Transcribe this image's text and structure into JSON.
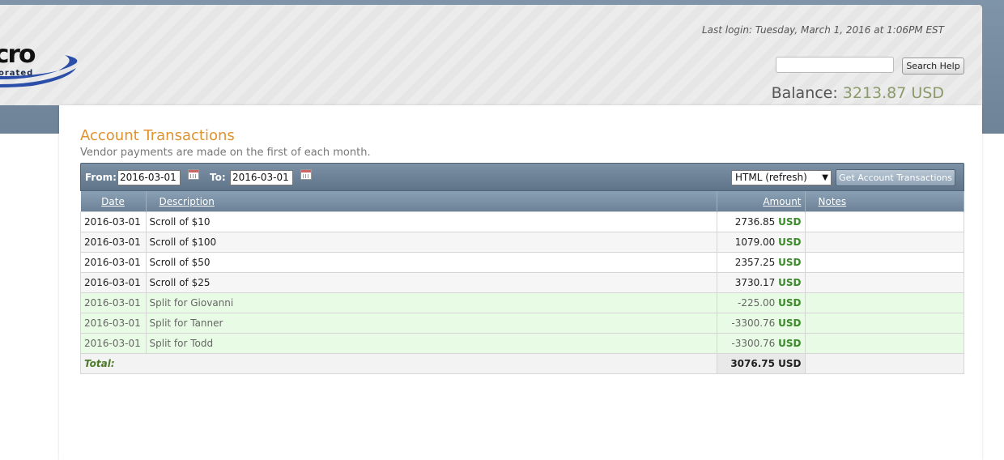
{
  "header": {
    "logo_mark": "cro",
    "logo_sub": "orated",
    "last_login": "Last login: Tuesday, March 1, 2016 at 1:06PM EST",
    "search_button": "Search Help",
    "balance_label": "Balance:",
    "balance_amount": "3213.87 USD"
  },
  "page": {
    "title": "Account Transactions",
    "subtitle": "Vendor payments are made on the first of each month."
  },
  "toolbar": {
    "from_label": "From:",
    "from_value": "2016-03-01",
    "to_label": "To:",
    "to_value": "2016-03-01",
    "format_value": "HTML (refresh)",
    "get_button": "Get Account Transactions"
  },
  "table": {
    "headers": {
      "date": "Date",
      "description": "Description",
      "amount": "Amount",
      "notes": "Notes"
    },
    "rows": [
      {
        "date": "2016-03-01",
        "description": "Scroll of $10",
        "amount": "2736.85",
        "currency": "USD",
        "notes": ""
      },
      {
        "date": "2016-03-01",
        "description": "Scroll of $100",
        "amount": "1079.00",
        "currency": "USD",
        "notes": ""
      },
      {
        "date": "2016-03-01",
        "description": "Scroll of $50",
        "amount": "2357.25",
        "currency": "USD",
        "notes": ""
      },
      {
        "date": "2016-03-01",
        "description": "Scroll of $25",
        "amount": "3730.17",
        "currency": "USD",
        "notes": ""
      },
      {
        "date": "2016-03-01",
        "description": "Split for Giovanni",
        "amount": "-225.00",
        "currency": "USD",
        "notes": ""
      },
      {
        "date": "2016-03-01",
        "description": "Split for Tanner",
        "amount": "-3300.76",
        "currency": "USD",
        "notes": ""
      },
      {
        "date": "2016-03-01",
        "description": "Split for Todd",
        "amount": "-3300.76",
        "currency": "USD",
        "notes": ""
      }
    ],
    "total_label": "Total:",
    "total_amount": "3076.75 USD"
  },
  "colors": {
    "accent_title": "#e0922e",
    "usd_green": "#3a8a2a",
    "split_row": "#e8fbe4"
  }
}
